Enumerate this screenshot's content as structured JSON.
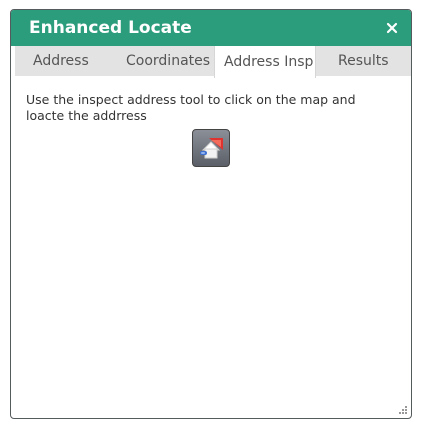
{
  "window": {
    "title": "Enhanced Locate",
    "close_label": "×",
    "colors": {
      "title_bar": "#2b9c7c",
      "tab_inactive": "#e3e3e3",
      "tab_active": "#ffffff"
    }
  },
  "tabs": [
    {
      "label": "Address",
      "active": false
    },
    {
      "label": "Coordinates",
      "active": false
    },
    {
      "label": "Address Insp",
      "active": true
    },
    {
      "label": "Results",
      "active": false
    }
  ],
  "content": {
    "instructions": "Use the inspect address tool to click on the map and loacte the addrress",
    "tool_icon": "inspect-address-icon"
  },
  "footer": {
    "resize_icon": "resize-grip-icon"
  }
}
